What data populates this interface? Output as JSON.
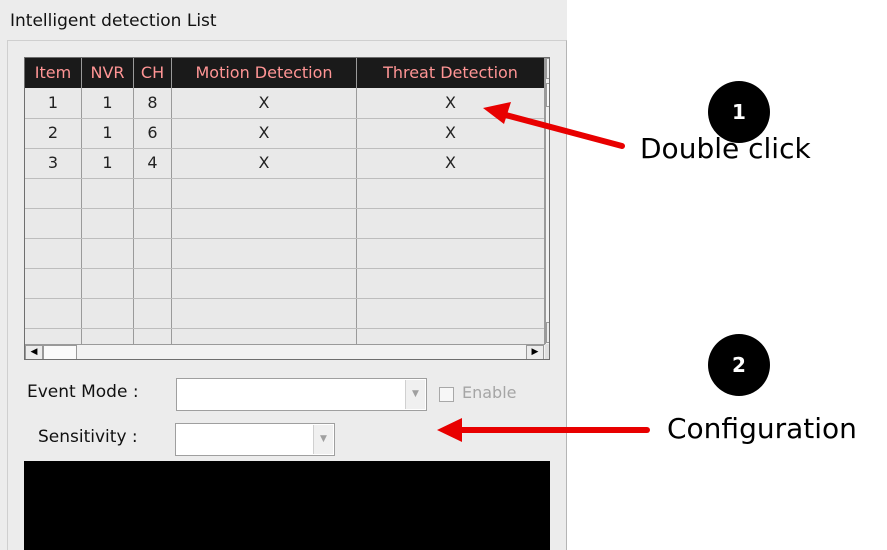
{
  "panel": {
    "title": "Intelligent detection List"
  },
  "table": {
    "columns": [
      "Item",
      "NVR",
      "CH",
      "Motion Detection",
      "Threat Detection"
    ],
    "rows": [
      [
        "1",
        "1",
        "8",
        "X",
        "X"
      ],
      [
        "2",
        "1",
        "6",
        "X",
        "X"
      ],
      [
        "3",
        "1",
        "4",
        "X",
        "X"
      ]
    ]
  },
  "form": {
    "event_mode_label": "Event Mode :",
    "event_mode_value": "",
    "enable_label": "Enable",
    "enable_checked": false,
    "sensitivity_label": "Sensitivity :",
    "sensitivity_value": ""
  },
  "annotations": {
    "step1_number": "1",
    "step1_text": "Double click",
    "step2_number": "2",
    "step2_text": "Configuration",
    "arrow_color": "#e80000"
  },
  "colors": {
    "header_bg": "#1a1a1a",
    "header_text": "#ff9595",
    "panel_bg": "#ececec"
  }
}
